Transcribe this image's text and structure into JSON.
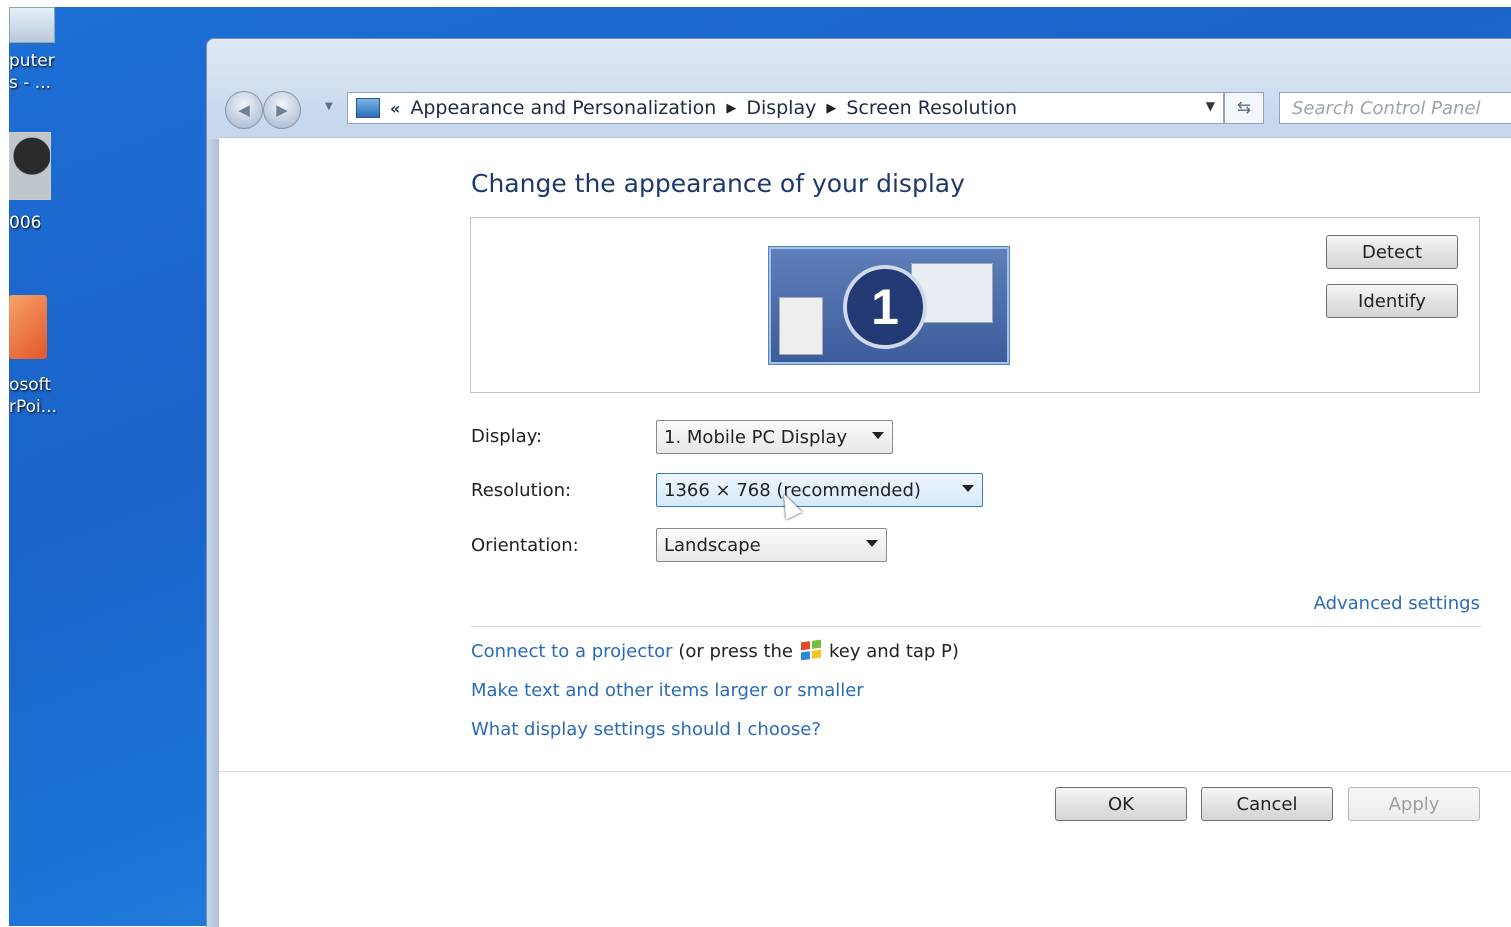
{
  "desktop": {
    "icons": [
      {
        "label_line1": "puter",
        "label_line2": "s - ..."
      },
      {
        "label_line1": "006",
        "label_line2": ""
      },
      {
        "label_line1": "osoft",
        "label_line2": "rPoi..."
      }
    ]
  },
  "navigation": {
    "breadcrumb": {
      "overflow": "«",
      "items": [
        "Appearance and Personalization",
        "Display",
        "Screen Resolution"
      ]
    },
    "search_placeholder": "Search Control Panel"
  },
  "page": {
    "title": "Change the appearance of your display",
    "monitor_number": "1",
    "detect_label": "Detect",
    "identify_label": "Identify",
    "fields": {
      "display_label": "Display:",
      "display_value": "1. Mobile PC Display",
      "resolution_label": "Resolution:",
      "resolution_value": "1366 × 768 (recommended)",
      "orientation_label": "Orientation:",
      "orientation_value": "Landscape"
    },
    "advanced_settings": "Advanced settings",
    "projector_link": "Connect to a projector",
    "projector_hint_before": "(or press the",
    "projector_hint_after": "key and tap P)",
    "text_size_link": "Make text and other items larger or smaller",
    "help_link": "What display settings should I choose?"
  },
  "footer": {
    "ok_label": "OK",
    "cancel_label": "Cancel",
    "apply_label": "Apply"
  }
}
